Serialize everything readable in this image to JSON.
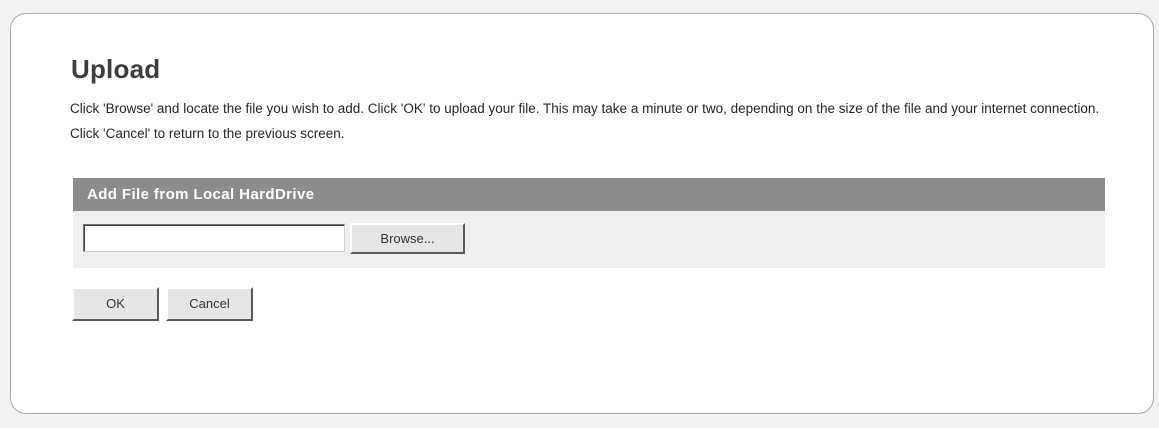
{
  "page": {
    "title": "Upload",
    "description": "Click 'Browse' and locate the file you wish to add. Click 'OK' to upload your file. This may take a minute or two, depending on the size of the file and your internet connection. Click 'Cancel' to return to the previous screen."
  },
  "section": {
    "header": "Add File from Local HardDrive",
    "file_input": {
      "value": "",
      "placeholder": ""
    },
    "browse_label": "Browse..."
  },
  "actions": {
    "ok_label": "OK",
    "cancel_label": "Cancel"
  },
  "colors": {
    "header_bg": "#8c8c8c",
    "section_bg": "#efefef",
    "button_bg": "#e6e6e6"
  }
}
